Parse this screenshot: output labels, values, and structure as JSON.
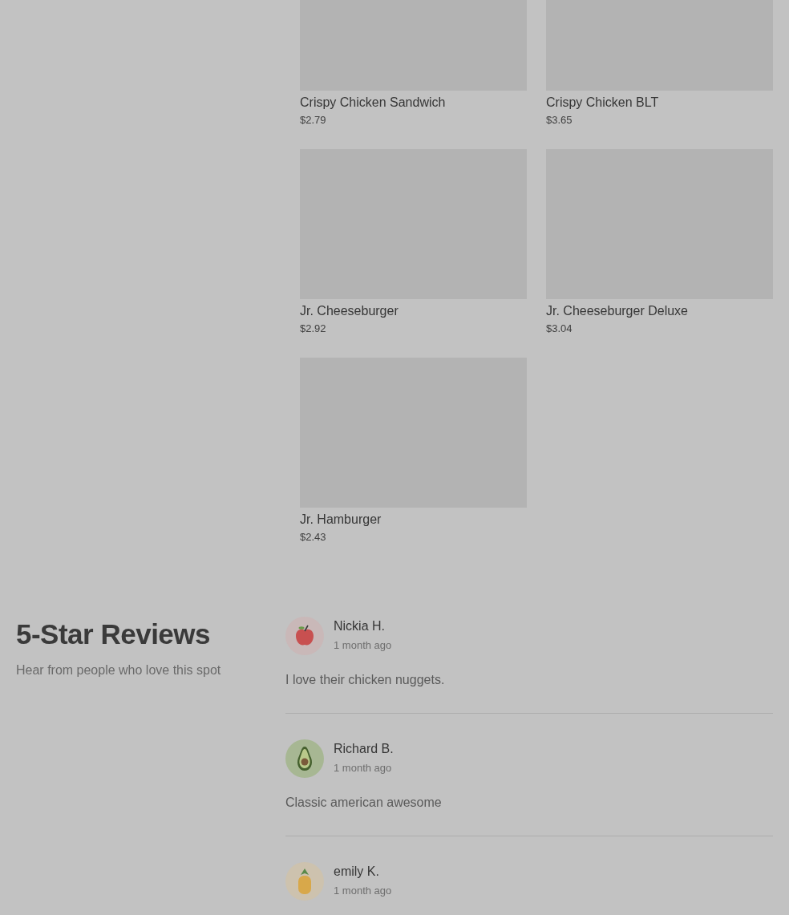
{
  "menu_items": [
    {
      "name": "Crispy Chicken Sandwich",
      "price": "$2.79"
    },
    {
      "name": "Crispy Chicken BLT",
      "price": "$3.65"
    },
    {
      "name": "Jr. Cheeseburger",
      "price": "$2.92"
    },
    {
      "name": "Jr. Cheeseburger Deluxe",
      "price": "$3.04"
    },
    {
      "name": "Jr. Hamburger",
      "price": "$2.43"
    }
  ],
  "reviews_section": {
    "title": "5-Star Reviews",
    "subtitle": "Hear from people who love this spot"
  },
  "reviews": [
    {
      "name": "Nickia H.",
      "time": "1 month ago",
      "text": "I love their chicken nuggets.",
      "avatar": {
        "kind": "apple"
      }
    },
    {
      "name": "Richard B.",
      "time": "1 month ago",
      "text": "Classic american awesome",
      "avatar": {
        "kind": "avocado"
      }
    },
    {
      "name": "emily K.",
      "time": "1 month ago",
      "avatar": {
        "kind": "pineapple"
      }
    }
  ]
}
